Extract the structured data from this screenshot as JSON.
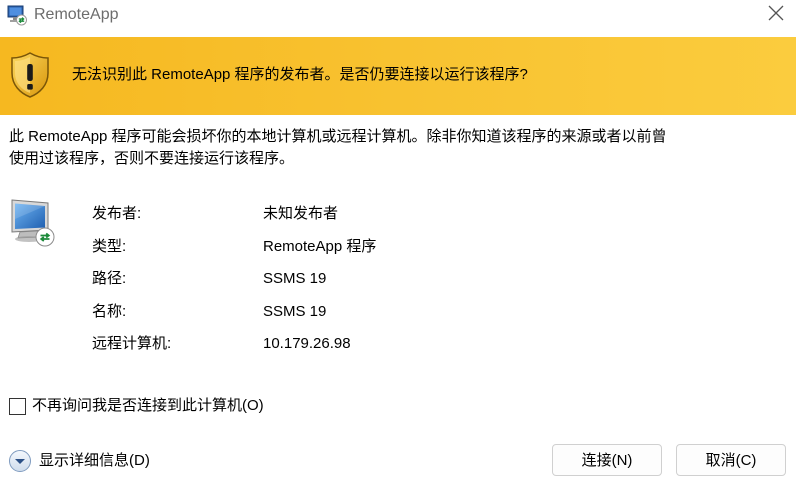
{
  "window": {
    "title": "RemoteApp",
    "app_icon": "remote-desktop-icon",
    "close_icon": "close-icon"
  },
  "banner": {
    "icon": "warning-shield-icon",
    "message": "无法识别此 RemoteApp 程序的发布者。是否仍要连接以运行该程序?",
    "color": "#f8c230"
  },
  "description": {
    "line1": "此 RemoteApp 程序可能会损坏你的本地计算机或远程计算机。除非你知道该程序的来源或者以前曾",
    "line2": "使用过该程序，否则不要连接运行该程序。"
  },
  "details": {
    "icon": "remote-computer-icon",
    "rows": [
      {
        "label": "发布者:",
        "value": "未知发布者"
      },
      {
        "label": "类型:",
        "value": "RemoteApp 程序"
      },
      {
        "label": "路径:",
        "value": "SSMS 19"
      },
      {
        "label": "名称:",
        "value": "SSMS 19"
      },
      {
        "label": "远程计算机:",
        "value": "10.179.26.98"
      }
    ]
  },
  "checkbox": {
    "label": "不再询问我是否连接到此计算机(O)",
    "checked": false
  },
  "expander": {
    "icon": "chevron-down-icon",
    "label": "显示详细信息(D)"
  },
  "buttons": {
    "connect": "连接(N)",
    "cancel": "取消(C)"
  }
}
